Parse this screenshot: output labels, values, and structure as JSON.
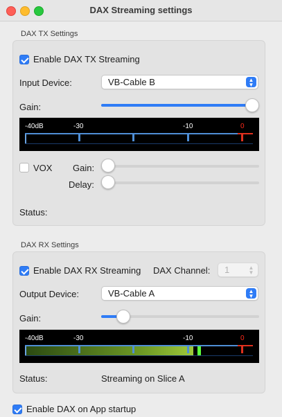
{
  "window": {
    "title": "DAX Streaming settings"
  },
  "tx": {
    "section_label": "DAX TX Settings",
    "enable_label": "Enable DAX TX Streaming",
    "enable_checked": true,
    "input_device_label": "Input Device:",
    "input_device_value": "VB-Cable B",
    "gain_label": "Gain:",
    "gain_level_fraction": 1.0,
    "meter": {
      "ticks": [
        "-40dB",
        "-30",
        "-10",
        "0"
      ],
      "level_fraction": 0.0
    },
    "vox_label": "VOX",
    "vox_checked": false,
    "vox_gain_label": "Gain:",
    "vox_gain_fraction": 0.0,
    "vox_delay_label": "Delay:",
    "vox_delay_fraction": 0.0,
    "status_label": "Status:",
    "status_value": ""
  },
  "rx": {
    "section_label": "DAX RX Settings",
    "enable_label": "Enable DAX RX Streaming",
    "enable_checked": true,
    "channel_label": "DAX Channel:",
    "channel_value": "1",
    "output_device_label": "Output Device:",
    "output_device_value": "VB-Cable A",
    "gain_label": "Gain:",
    "gain_level_fraction": 0.14,
    "meter": {
      "ticks": [
        "-40dB",
        "-30",
        "-10",
        "0"
      ],
      "level_fraction": 0.73
    },
    "status_label": "Status:",
    "status_value": "Streaming on Slice A"
  },
  "startup": {
    "label": "Enable DAX on App startup",
    "checked": true
  },
  "colors": {
    "accent": "#2f7cf6",
    "meter_red": "#e0301e",
    "meter_peak": "#5cff3c"
  }
}
